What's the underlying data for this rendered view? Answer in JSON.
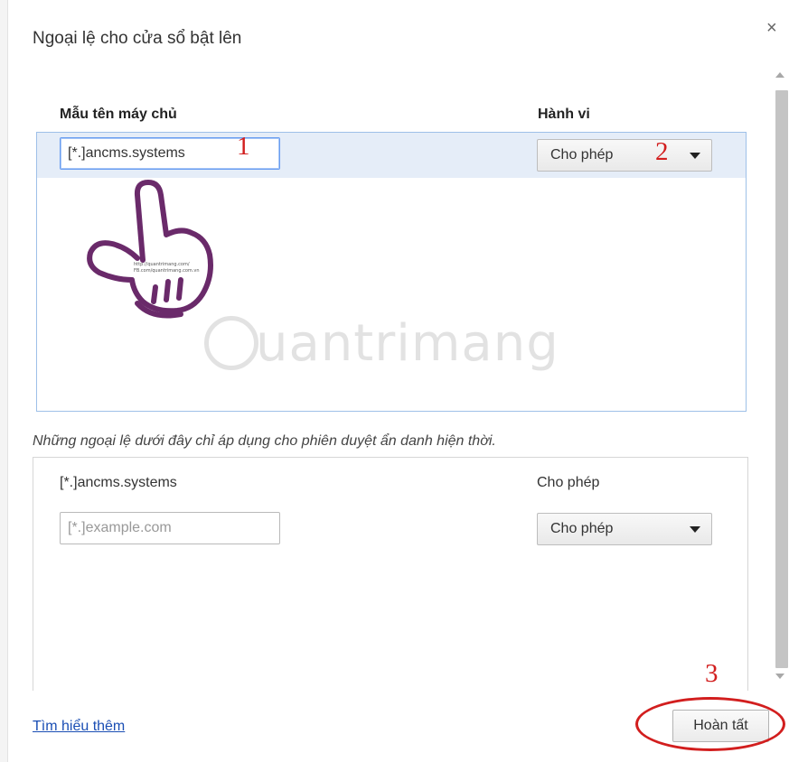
{
  "dialog": {
    "title": "Ngoại lệ cho cửa sổ bật lên",
    "close_glyph": "×"
  },
  "table": {
    "col_hostname": "Mẫu tên máy chủ",
    "col_behavior": "Hành vi",
    "rows": [
      {
        "hostname": "[*.]ancms.systems",
        "behavior": "Cho phép"
      }
    ]
  },
  "annotations": {
    "a1": "1",
    "a2": "2",
    "a3": "3"
  },
  "watermark": {
    "brand": "uantrimang",
    "hand_text_1": "http://quantrimang.com/",
    "hand_text_2": "FB.com/quantrimang.com.vn"
  },
  "incognito": {
    "note": "Những ngoại lệ dưới đây chỉ áp dụng cho phiên duyệt ẩn danh hiện thời.",
    "rows": [
      {
        "hostname": "[*.]ancms.systems",
        "behavior": "Cho phép"
      }
    ],
    "new_hostname_placeholder": "[*.]example.com",
    "new_behavior": "Cho phép"
  },
  "footer": {
    "learn_more": "Tìm hiểu thêm",
    "done": "Hoàn tất"
  },
  "colors": {
    "annotation": "#d21e1e",
    "link": "#1a4eb4",
    "selected_row": "#e5edf8",
    "hand": "#6a2a6a"
  },
  "icons": [
    "close-icon",
    "dropdown-arrow-icon",
    "scroll-up-icon",
    "scroll-down-icon",
    "pointing-hand-icon",
    "lightbulb-icon"
  ]
}
